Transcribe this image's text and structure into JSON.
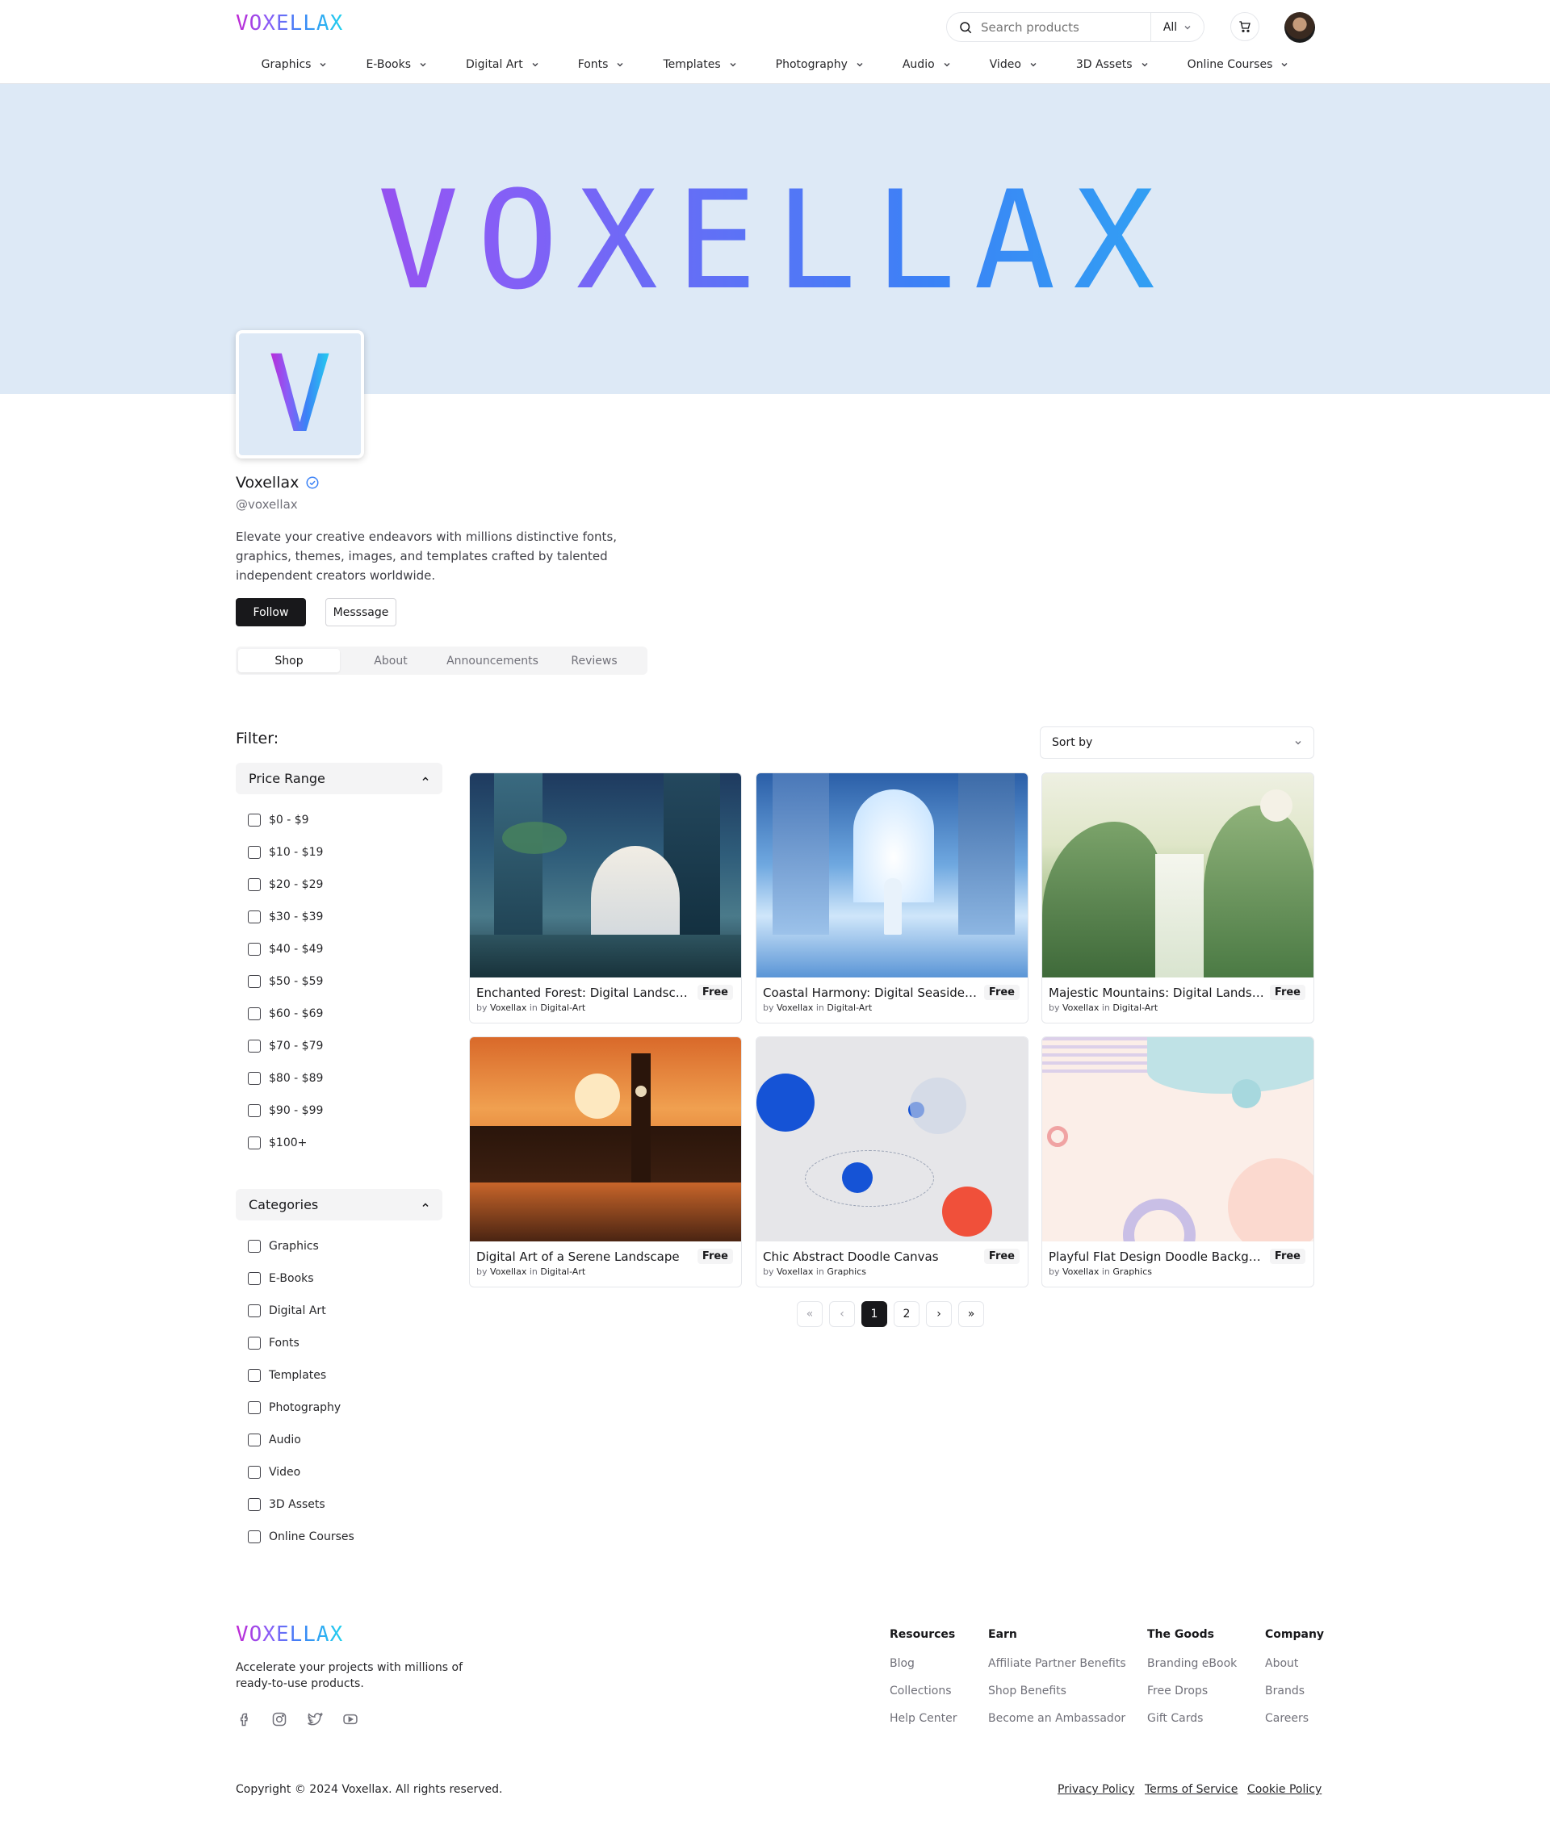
{
  "header": {
    "logo": "VOXELLAX",
    "search_placeholder": "Search products",
    "search_scope": "All"
  },
  "nav": [
    "Graphics",
    "E-Books",
    "Digital Art",
    "Fonts",
    "Templates",
    "Photography",
    "Audio",
    "Video",
    "3D Assets",
    "Online Courses"
  ],
  "banner": {
    "logo": "VOXELLAX"
  },
  "profile": {
    "initial": "V",
    "name": "Voxellax",
    "handle": "@voxellax",
    "bio": "Elevate your creative endeavors with millions distinctive fonts, graphics, themes, images, and templates crafted by talented independent creators worldwide.",
    "follow_label": "Follow",
    "message_label": "Messsage",
    "tabs": [
      "Shop",
      "About",
      "Announcements",
      "Reviews"
    ]
  },
  "filter": {
    "title": "Filter:",
    "price_title": "Price Range",
    "prices": [
      "$0 - $9",
      "$10 - $19",
      "$20 - $29",
      "$30 - $39",
      "$40 - $49",
      "$50 - $59",
      "$60 - $69",
      "$70 - $79",
      "$80 - $89",
      "$90 - $99",
      "$100+"
    ],
    "categories_title": "Categories",
    "categories": [
      "Graphics",
      "E-Books",
      "Digital Art",
      "Fonts",
      "Templates",
      "Photography",
      "Audio",
      "Video",
      "3D Assets",
      "Online Courses"
    ]
  },
  "sort": {
    "label": "Sort by"
  },
  "products": [
    {
      "title": "Enchanted Forest: Digital Landscape Art",
      "price": "Free",
      "by": "by",
      "author": "Voxellax",
      "in": "in",
      "category": "Digital-Art"
    },
    {
      "title": "Coastal Harmony: Digital Seaside Scenery",
      "price": "Free",
      "by": "by",
      "author": "Voxellax",
      "in": "in",
      "category": "Digital-Art"
    },
    {
      "title": "Majestic Mountains: Digital Landscape Art",
      "price": "Free",
      "by": "by",
      "author": "Voxellax",
      "in": "in",
      "category": "Digital-Art"
    },
    {
      "title": "Digital Art of a Serene Landscape",
      "price": "Free",
      "by": "by",
      "author": "Voxellax",
      "in": "in",
      "category": "Digital-Art"
    },
    {
      "title": "Chic Abstract Doodle Canvas",
      "price": "Free",
      "by": "by",
      "author": "Voxellax",
      "in": "in",
      "category": "Graphics"
    },
    {
      "title": "Playful Flat Design Doodle Background",
      "price": "Free",
      "by": "by",
      "author": "Voxellax",
      "in": "in",
      "category": "Graphics"
    }
  ],
  "pagination": {
    "pages": [
      "1",
      "2"
    ],
    "current": "1"
  },
  "footer": {
    "logo": "VOXELLAX",
    "tagline": "Accelerate your projects with millions of ready-to-use products.",
    "social_icons": [
      "facebook-icon",
      "instagram-icon",
      "twitter-icon",
      "youtube-icon"
    ],
    "columns": [
      {
        "title": "Resources",
        "links": [
          "Blog",
          "Collections",
          "Help Center"
        ]
      },
      {
        "title": "Earn",
        "links": [
          "Affiliate Partner Benefits",
          "Shop Benefits",
          "Become an Ambassador"
        ]
      },
      {
        "title": "The Goods",
        "links": [
          "Branding eBook",
          "Free Drops",
          "Gift Cards"
        ]
      },
      {
        "title": "Company",
        "links": [
          "About",
          "Brands",
          "Careers"
        ]
      }
    ],
    "copyright": "Copyright © 2024 Voxellax. All rights reserved.",
    "legal": [
      "Privacy Policy",
      "Terms of Service",
      "Cookie Policy"
    ]
  },
  "colors": {
    "brand_gradient": [
      "#c026d3",
      "#8b5cf6",
      "#3b82f6",
      "#22d3ee"
    ],
    "banner_bg": "#dde9f6",
    "dark": "#18181b"
  }
}
